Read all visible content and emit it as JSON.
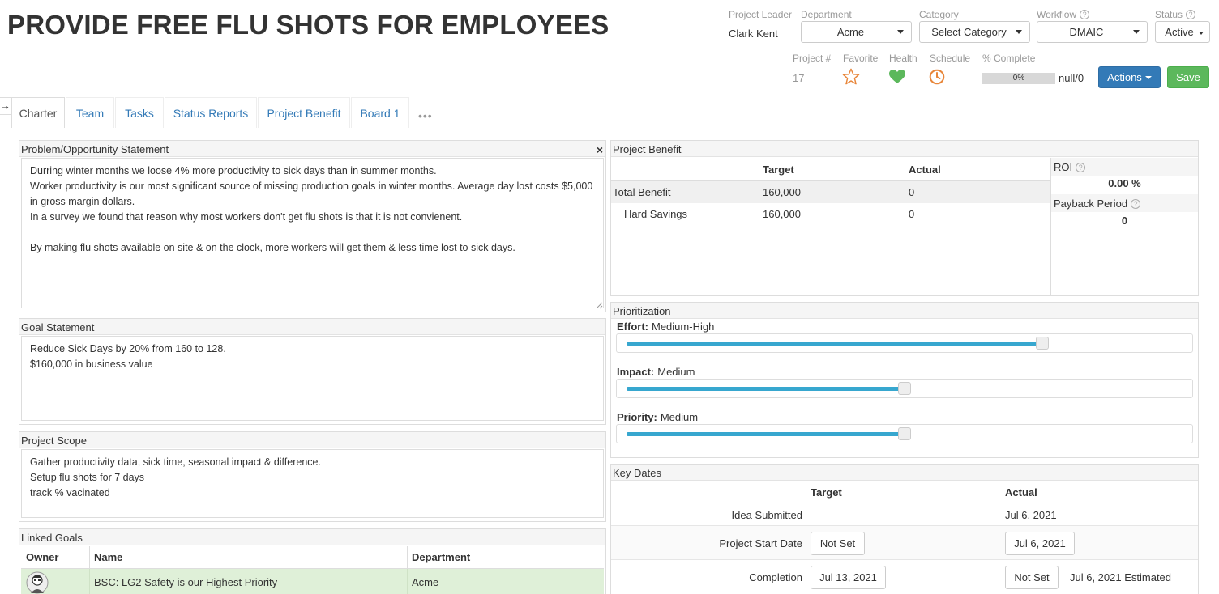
{
  "header": {
    "title": "PROVIDE FREE FLU SHOTS FOR EMPLOYEES",
    "project_leader_label": "Project Leader",
    "project_leader": "Clark Kent",
    "department_label": "Department",
    "department": "Acme",
    "category_label": "Category",
    "category": "Select Category",
    "workflow_label": "Workflow",
    "workflow": "DMAIC",
    "status_label": "Status",
    "status": "Active",
    "project_num_label": "Project #",
    "project_num": "17",
    "favorite_label": "Favorite",
    "health_label": "Health",
    "schedule_label": "Schedule",
    "complete_label": "% Complete",
    "complete_pct_text": "0%",
    "complete_fraction": 0,
    "complete_ratio": "null/0",
    "actions_label": "Actions",
    "save_label": "Save",
    "help_glyph": "?",
    "colors": {
      "favorite": "#e8863a",
      "health": "#5cb85c",
      "schedule": "#e8863a",
      "primary": "#337ab7",
      "success": "#5cb85c"
    }
  },
  "tabs": [
    "Charter",
    "Team",
    "Tasks",
    "Status Reports",
    "Project Benefit",
    "Board 1"
  ],
  "tab_more": "•••",
  "side_arrow": "→",
  "problem": {
    "title": "Problem/Opportunity Statement",
    "close": "×",
    "lines": [
      "Durring winter months we loose 4% more productivity to sick days than in summer months.",
      "Worker productivity is our most significant source of missing production goals in winter months. Average day lost costs $5,000 in gross margin dollars.",
      "In a survey we found that reason why most workers don't get flu shots is that it is not convienent.",
      "",
      "By making flu shots available on site & on the clock, more workers will get them & less time lost to sick days."
    ]
  },
  "goal": {
    "title": "Goal Statement",
    "lines": [
      "Reduce Sick Days by 20% from 160 to 128.",
      "$160,000 in business value"
    ]
  },
  "scope": {
    "title": "Project Scope",
    "lines": [
      "Gather productivity data, sick time, seasonal impact & difference.",
      "Setup flu shots for 7 days",
      "track % vacinated"
    ]
  },
  "linked_goals": {
    "title": "Linked Goals",
    "columns": [
      "Owner",
      "Name",
      "Department"
    ],
    "rows": [
      {
        "name": "BSC: LG2 Safety is our Highest Priority",
        "department": "Acme"
      }
    ]
  },
  "benefit": {
    "title": "Project Benefit",
    "col_target": "Target",
    "col_actual": "Actual",
    "rows": [
      {
        "label": "Total Benefit",
        "target": "160,000",
        "actual": "0"
      },
      {
        "label": "Hard Savings",
        "target": "160,000",
        "actual": "0"
      }
    ],
    "roi_label": "ROI",
    "roi_value": "0.00 %",
    "payback_label": "Payback Period",
    "payback_value": "0"
  },
  "prioritization": {
    "title": "Prioritization",
    "sliders": [
      {
        "label": "Effort:",
        "value_text": "Medium-High",
        "level": 0.75
      },
      {
        "label": "Impact:",
        "value_text": "Medium",
        "level": 0.5
      },
      {
        "label": "Priority:",
        "value_text": "Medium",
        "level": 0.5
      }
    ]
  },
  "key_dates": {
    "title": "Key Dates",
    "col_target": "Target",
    "col_actual": "Actual",
    "idea_label": "Idea Submitted",
    "idea_actual": "Jul 6, 2021",
    "start_label": "Project Start Date",
    "start_target": "Not Set",
    "start_actual": "Jul 6, 2021",
    "completion_label": "Completion",
    "completion_target": "Jul 13, 2021",
    "completion_actual": "Not Set",
    "completion_estimated": "Jul 6, 2021 Estimated"
  }
}
